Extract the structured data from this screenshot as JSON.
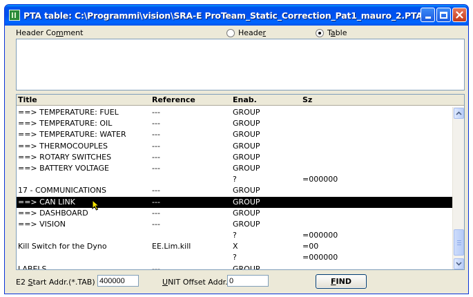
{
  "window": {
    "title": "PTA table: C:\\Programmi\\vision\\SRA-E ProTeam_Static_Correction_Pat1_mauro_2.PTA"
  },
  "header": {
    "comment_label": "Header Comment",
    "radio_header_label": "Header",
    "radio_table_label": "Table",
    "selected": "Table",
    "comment_value": ""
  },
  "table": {
    "columns": [
      "Title",
      "Reference",
      "Enab.",
      "Sz"
    ],
    "rows": [
      {
        "title": "==> TEMPERATURE: FUEL",
        "ref": "---",
        "enab": "GROUP",
        "sz": ""
      },
      {
        "title": "==> TEMPERATURE: OIL",
        "ref": "---",
        "enab": "GROUP",
        "sz": ""
      },
      {
        "title": "==> TEMPERATURE: WATER",
        "ref": "---",
        "enab": "GROUP",
        "sz": ""
      },
      {
        "title": "==> THERMOCOUPLES",
        "ref": "---",
        "enab": "GROUP",
        "sz": ""
      },
      {
        "title": "==> ROTARY SWITCHES",
        "ref": "---",
        "enab": "GROUP",
        "sz": ""
      },
      {
        "title": "==> BATTERY VOLTAGE",
        "ref": "---",
        "enab": "GROUP",
        "sz": ""
      },
      {
        "title": "",
        "ref": "",
        "enab": "?",
        "sz": "=000000"
      },
      {
        "title": "17 - COMMUNICATIONS",
        "ref": "---",
        "enab": "GROUP",
        "sz": ""
      },
      {
        "title": "==> CAN LINK",
        "ref": "---",
        "enab": "GROUP",
        "sz": "",
        "selected": true
      },
      {
        "title": "==> DASHBOARD",
        "ref": "---",
        "enab": "GROUP",
        "sz": ""
      },
      {
        "title": "==> VISION",
        "ref": "---",
        "enab": "GROUP",
        "sz": ""
      },
      {
        "title": "",
        "ref": "",
        "enab": "?",
        "sz": "=000000"
      },
      {
        "title": "Kill Switch for the Dyno",
        "ref": "EE.Lim.kill",
        "enab": "X",
        "sz": "=00"
      },
      {
        "title": "",
        "ref": "",
        "enab": "?",
        "sz": "=000000"
      },
      {
        "title": "LABELS",
        "ref": "---",
        "enab": "GROUP",
        "sz": ""
      }
    ]
  },
  "footer": {
    "e2_label": "E2 Start Addr.(*.TAB)",
    "e2_value": "400000",
    "unit_label": "UNIT Offset Addr.",
    "unit_value": "0",
    "find_label": "FIND"
  },
  "icons": [
    "app-icon",
    "minimize-icon",
    "maximize-icon",
    "close-icon",
    "scroll-up-icon",
    "scroll-down-icon",
    "mouse-cursor-icon"
  ],
  "colors": {
    "titlebar": "#0054e3",
    "selection": "#000000",
    "window_bg": "#ece9d8"
  }
}
